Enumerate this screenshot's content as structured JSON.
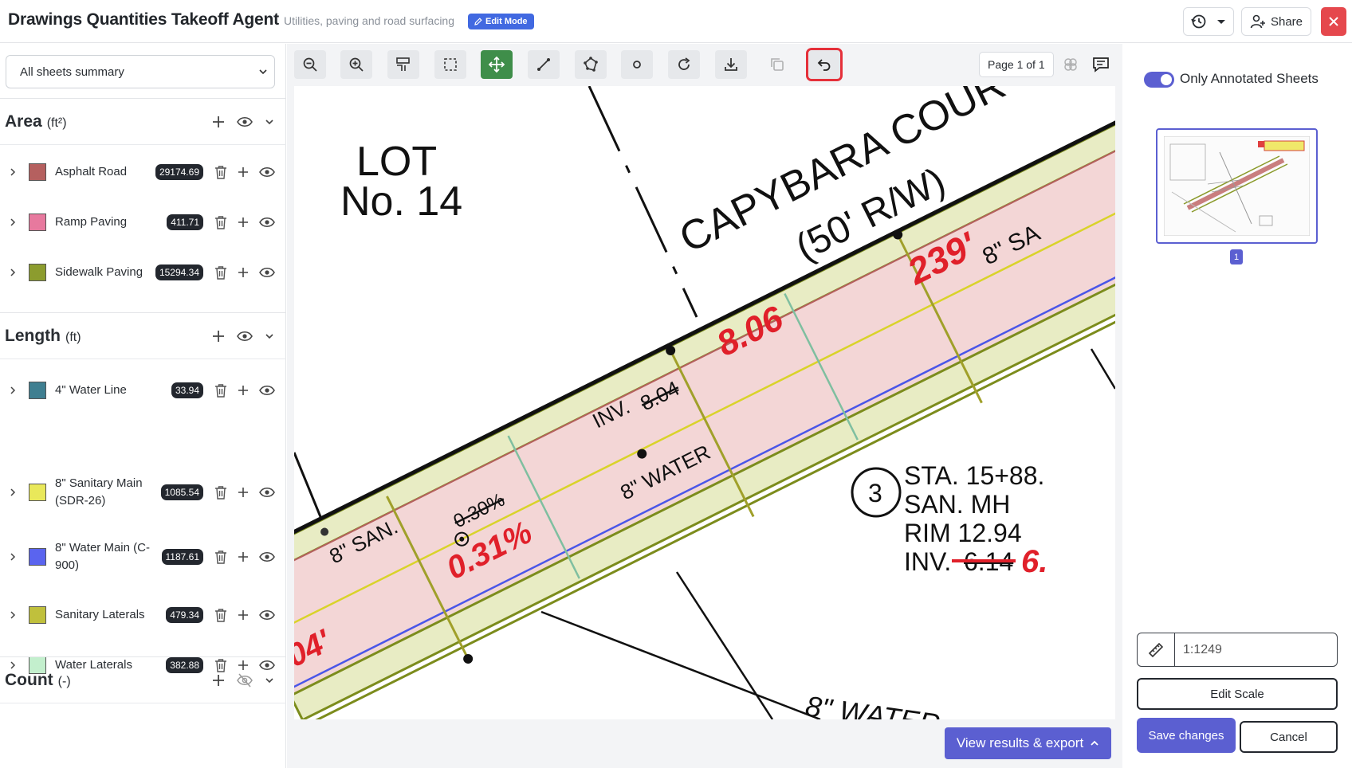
{
  "header": {
    "title": "Drawings Quantities Takeoff Agent",
    "subtitle": "Utilities, paving and road surfacing",
    "edit_badge": "Edit Mode",
    "share_label": "Share"
  },
  "sidebar": {
    "sheet_select": "All sheets summary",
    "sections": [
      {
        "title": "Area",
        "unit": "(ft²)",
        "items": [
          {
            "label": "Asphalt Road",
            "value": "29174.69",
            "color": "#b5605f"
          },
          {
            "label": "Ramp Paving",
            "value": "411.71",
            "color": "#e7799e"
          },
          {
            "label": "Sidewalk Paving",
            "value": "15294.34",
            "color": "#8c9c2e"
          }
        ]
      },
      {
        "title": "Length",
        "unit": "(ft)",
        "items": [
          {
            "label": "4\" Water Line",
            "value": "33.94",
            "color": "#3f7f91"
          },
          {
            "label": "8\" Sanitary Main (SDR-26)",
            "value": "1085.54",
            "color": "#e9e85a"
          },
          {
            "label": "8\" Water Main (C-900)",
            "value": "1187.61",
            "color": "#5a64ef"
          },
          {
            "label": "Sanitary Laterals",
            "value": "479.34",
            "color": "#c0c03c"
          },
          {
            "label": "Water Laterals",
            "value": "382.88",
            "color": "#c3efcd"
          }
        ]
      },
      {
        "title": "Count",
        "unit": "(-)",
        "items": []
      }
    ]
  },
  "canvas": {
    "page_indicator": "Page 1 of 1",
    "results_button": "View results & export",
    "drawing_text": {
      "lot": "LOT",
      "lot_no": "No. 14",
      "street": "CAPYBARA COUR",
      "row": "(50' R/W)",
      "dim_239": "239'",
      "dim_806": "8.06",
      "inv": "INV.",
      "inv_old": "8.04",
      "water": "8\" WATER",
      "san": "8\" SAN.",
      "slope": "0.31%",
      "slope_old": "0.30%",
      "dim_04": "04'",
      "sa": "8\" SA",
      "sta": "STA. 15+88.",
      "san_mh": "SAN. MH",
      "rim": "RIM 12.94",
      "inv2": "INV.",
      "inv2_old": "6.14",
      "inv2_new": "6.",
      "node": "3",
      "water_bottom": "8\" WATER"
    }
  },
  "right_panel": {
    "toggle_label": "Only Annotated Sheets",
    "thumb_page": "1",
    "scale_value": "1:1249",
    "edit_scale": "Edit Scale",
    "save": "Save changes",
    "cancel": "Cancel"
  },
  "colors": {
    "accent": "#5b5fd1",
    "edit_badge": "#4169e1",
    "active_tool": "#3f8e4a",
    "close": "#e5484d"
  }
}
